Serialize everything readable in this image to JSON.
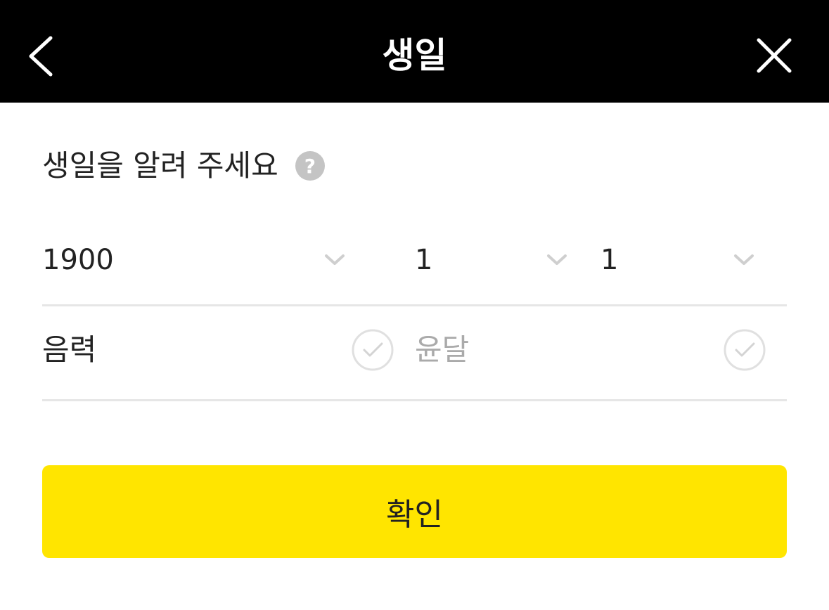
{
  "header": {
    "title": "생일",
    "back_icon": "chevron-left-icon",
    "close_icon": "close-icon",
    "background": "#000000"
  },
  "prompt": {
    "text": "생일을 알려 주세요",
    "help_icon_glyph": "?"
  },
  "date": {
    "year": "1900",
    "month": "1",
    "day": "1"
  },
  "options": {
    "lunar_label": "음력",
    "lunar_checked": false,
    "leap_label": "윤달",
    "leap_checked": false,
    "leap_enabled": false
  },
  "confirm": {
    "label": "확인",
    "color": "#ffe500"
  }
}
